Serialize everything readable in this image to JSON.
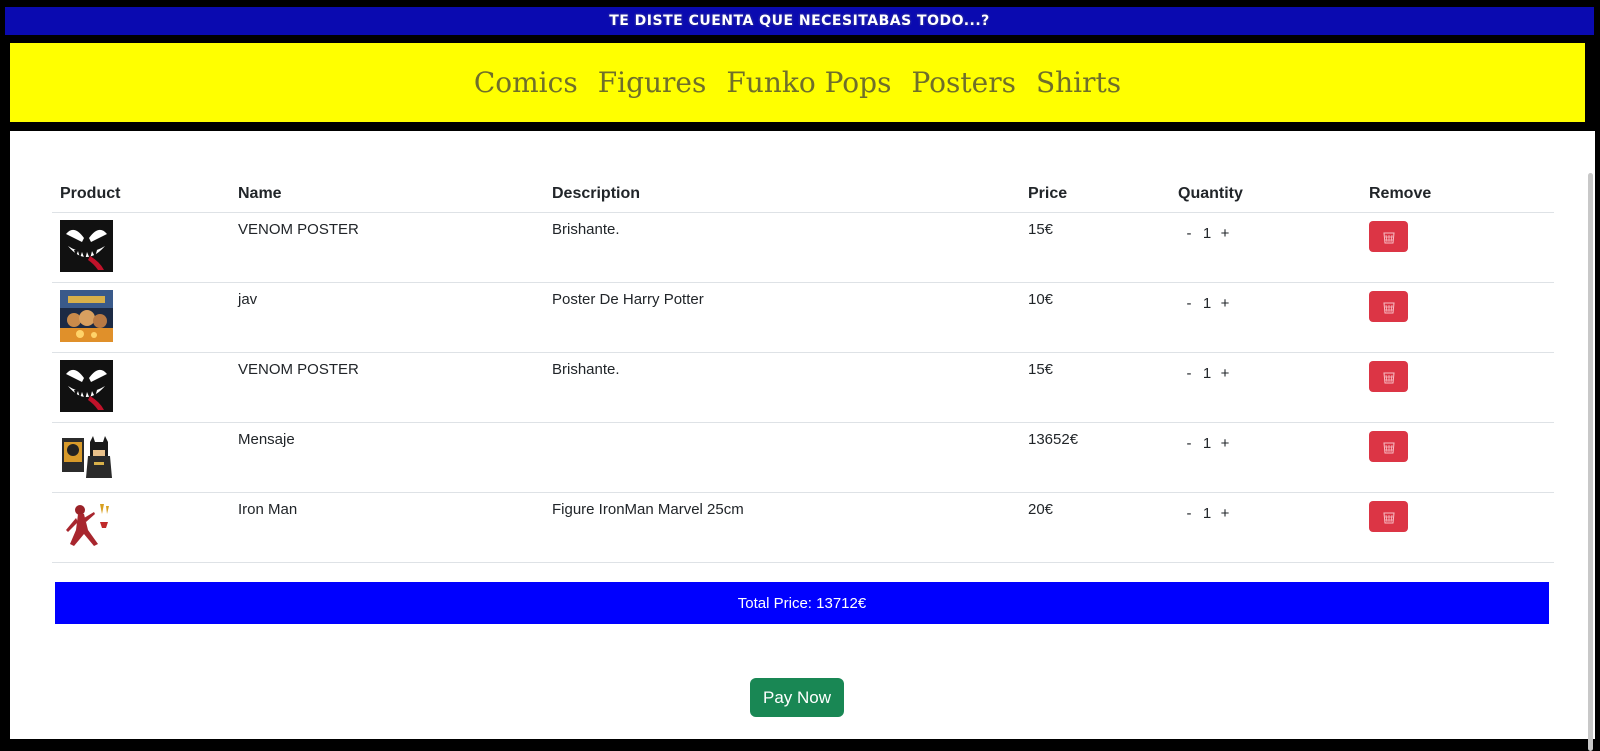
{
  "banner": {
    "text": "TE DISTE CUENTA QUE NECESITABAS TODO...?"
  },
  "nav": {
    "items": [
      {
        "label": "Comics"
      },
      {
        "label": "Figures"
      },
      {
        "label": "Funko Pops"
      },
      {
        "label": "Posters"
      },
      {
        "label": "Shirts"
      }
    ]
  },
  "cart": {
    "headers": {
      "product": "Product",
      "name": "Name",
      "description": "Description",
      "price": "Price",
      "quantity": "Quantity",
      "remove": "Remove"
    },
    "rows": [
      {
        "image": "venom-image",
        "name": "VENOM POSTER",
        "description": "Brishante.",
        "price": "15€",
        "quantity": "1"
      },
      {
        "image": "harry-potter-image",
        "name": "jav",
        "description": "Poster De Harry Potter",
        "price": "10€",
        "quantity": "1"
      },
      {
        "image": "venom-image",
        "name": "VENOM POSTER",
        "description": "Brishante.",
        "price": "15€",
        "quantity": "1"
      },
      {
        "image": "batman-funko-image",
        "name": "Mensaje",
        "description": "",
        "price": "13652€",
        "quantity": "1"
      },
      {
        "image": "ironman-figure-image",
        "name": "Iron Man",
        "description": "Figure IronMan Marvel 25cm",
        "price": "20€",
        "quantity": "1"
      }
    ],
    "minus": "-",
    "plus": "+",
    "remove_icon": "trash-icon",
    "total": "Total Price: 13712€",
    "pay_label": "Pay Now"
  },
  "colors": {
    "banner": "#0a0ab0",
    "navbar": "#ffff00",
    "nav_link": "#6f6f2a",
    "remove": "#dc3545",
    "total_bar": "#0000ff",
    "pay": "#198754"
  }
}
